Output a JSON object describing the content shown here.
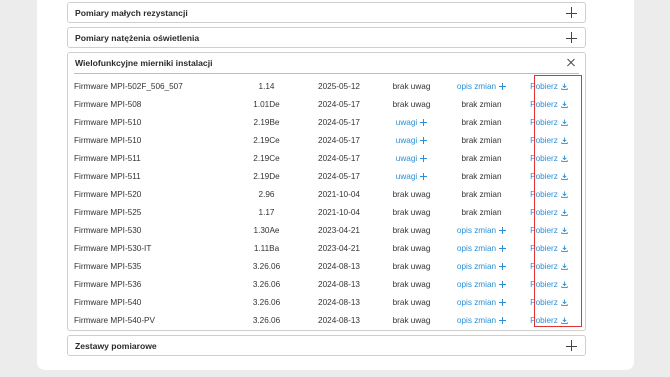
{
  "sections": {
    "small_resistance": "Pomiary małych rezystancji",
    "light_intensity": "Pomiary natężenia oświetlenia",
    "multifunction": "Wielofunkcyjne mierniki instalacji",
    "kits": "Zestawy pomiarowe"
  },
  "rows": [
    {
      "name": "Firmware MPI-502F_506_507",
      "version": "1.14",
      "date": "2025-05-12",
      "notes": "brak uwag",
      "changes": "opis zmian",
      "download": "Pobierz"
    },
    {
      "name": "Firmware MPI-508",
      "version": "1.01De",
      "date": "2024-05-17",
      "notes": "brak uwag",
      "changes": "brak zmian",
      "download": "Pobierz"
    },
    {
      "name": "Firmware MPI-510",
      "version": "2.19Be",
      "date": "2024-05-17",
      "notes": "uwagi",
      "changes": "brak zmian",
      "download": "Pobierz"
    },
    {
      "name": "Firmware MPI-510",
      "version": "2.19Ce",
      "date": "2024-05-17",
      "notes": "uwagi",
      "changes": "brak zmian",
      "download": "Pobierz"
    },
    {
      "name": "Firmware MPI-511",
      "version": "2.19Ce",
      "date": "2024-05-17",
      "notes": "uwagi",
      "changes": "brak zmian",
      "download": "Pobierz"
    },
    {
      "name": "Firmware MPI-511",
      "version": "2.19De",
      "date": "2024-05-17",
      "notes": "uwagi",
      "changes": "brak zmian",
      "download": "Pobierz"
    },
    {
      "name": "Firmware MPI-520",
      "version": "2.96",
      "date": "2021-10-04",
      "notes": "brak uwag",
      "changes": "brak zmian",
      "download": "Pobierz"
    },
    {
      "name": "Firmware MPI-525",
      "version": "1.17",
      "date": "2021-10-04",
      "notes": "brak uwag",
      "changes": "brak zmian",
      "download": "Pobierz"
    },
    {
      "name": "Firmware MPI-530",
      "version": "1.30Ae",
      "date": "2023-04-21",
      "notes": "brak uwag",
      "changes": "opis zmian",
      "download": "Pobierz"
    },
    {
      "name": "Firmware MPI-530-IT",
      "version": "1.11Ba",
      "date": "2023-04-21",
      "notes": "brak uwag",
      "changes": "opis zmian",
      "download": "Pobierz"
    },
    {
      "name": "Firmware MPI-535",
      "version": "3.26.06",
      "date": "2024-08-13",
      "notes": "brak uwag",
      "changes": "opis zmian",
      "download": "Pobierz"
    },
    {
      "name": "Firmware MPI-536",
      "version": "3.26.06",
      "date": "2024-08-13",
      "notes": "brak uwag",
      "changes": "opis zmian",
      "download": "Pobierz"
    },
    {
      "name": "Firmware MPI-540",
      "version": "3.26.06",
      "date": "2024-08-13",
      "notes": "brak uwag",
      "changes": "opis zmian",
      "download": "Pobierz"
    },
    {
      "name": "Firmware MPI-540-PV",
      "version": "3.26.06",
      "date": "2024-08-13",
      "notes": "brak uwag",
      "changes": "opis zmian",
      "download": "Pobierz"
    }
  ],
  "colors": {
    "link": "#2a8fd6",
    "highlight": "#e03434"
  }
}
